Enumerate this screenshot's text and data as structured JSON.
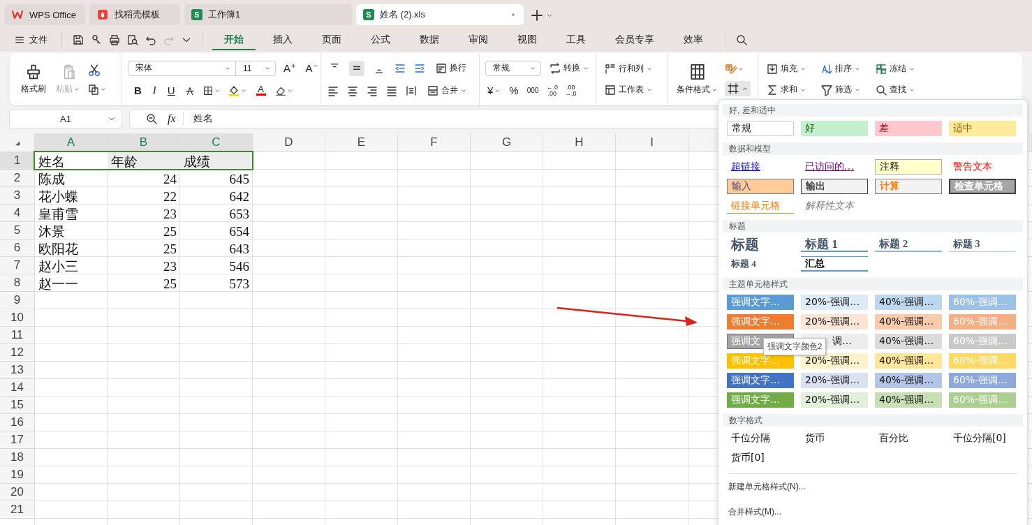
{
  "tabs": [
    {
      "label": "WPS Office",
      "kind": "wps",
      "selected": false
    },
    {
      "label": "找稻壳模板",
      "kind": "template",
      "selected": false
    },
    {
      "label": "工作簿1",
      "kind": "sheet",
      "badge": "S",
      "selected": false
    },
    {
      "label": "姓名 (2).xls",
      "kind": "sheet",
      "badge": "S",
      "selected": true
    }
  ],
  "menu": {
    "file": "文件",
    "tabs": [
      {
        "label": "开始",
        "selected": true
      },
      {
        "label": "插入",
        "selected": false
      },
      {
        "label": "页面",
        "selected": false
      },
      {
        "label": "公式",
        "selected": false
      },
      {
        "label": "数据",
        "selected": false
      },
      {
        "label": "审阅",
        "selected": false
      },
      {
        "label": "视图",
        "selected": false
      },
      {
        "label": "工具",
        "selected": false
      },
      {
        "label": "会员专享",
        "selected": false
      },
      {
        "label": "效率",
        "selected": false
      }
    ]
  },
  "ribbon": {
    "clipboard": {
      "format_painter": "格式刷",
      "paste": "粘贴",
      "paste_disabled": true
    },
    "font": {
      "name": "宋体",
      "size": "11",
      "grow": "A",
      "grow_mark": "+",
      "shrink": "A",
      "shrink_mark": "−",
      "bold": "B",
      "italic": "I",
      "underline": "U",
      "color_letter": "A"
    },
    "alignment": {
      "vertical": [
        {
          "selected": false
        },
        {
          "selected": true
        },
        {
          "selected": false
        }
      ],
      "wrap": "换行",
      "merge": "合并"
    },
    "number": {
      "format": "常规",
      "convert": "转换",
      "currency": "¥",
      "percent": "%",
      "thousands": "000",
      "inc_decimal": [
        "←.0",
        ".00"
      ],
      "dec_decimal": [
        ".00",
        "→.0"
      ]
    },
    "cells": {
      "rows_cols": "行和列",
      "worksheet": "工作表"
    },
    "styles": {
      "conditional": "条件格式",
      "cell_styles_expanded": true
    },
    "editing": [
      {
        "label": "填充",
        "kind": "fill"
      },
      {
        "label": "排序",
        "kind": "sort"
      },
      {
        "label": "冻结",
        "kind": "freeze"
      },
      {
        "label": "求和",
        "kind": "sum"
      },
      {
        "label": "筛选",
        "kind": "filter"
      },
      {
        "label": "查找",
        "kind": "find"
      }
    ]
  },
  "formula_bar": {
    "cell_ref": "A1",
    "fx": "fx",
    "value": "姓名"
  },
  "sheet": {
    "columns": [
      {
        "label": "A",
        "selected": true
      },
      {
        "label": "B",
        "selected": true
      },
      {
        "label": "C",
        "selected": true
      },
      {
        "label": "D",
        "selected": false
      },
      {
        "label": "E",
        "selected": false
      },
      {
        "label": "F",
        "selected": false
      },
      {
        "label": "G",
        "selected": false
      },
      {
        "label": "H",
        "selected": false
      },
      {
        "label": "I",
        "selected": false
      }
    ],
    "rows": [
      {
        "label": "1",
        "selected": true,
        "cells": [
          {
            "text": "姓名",
            "kind": "text"
          },
          {
            "text": "年龄",
            "kind": "text"
          },
          {
            "text": "成绩",
            "kind": "text"
          }
        ]
      },
      {
        "label": "2",
        "selected": false,
        "cells": [
          {
            "text": "陈成",
            "kind": "text"
          },
          {
            "text": "24",
            "kind": "number"
          },
          {
            "text": "645",
            "kind": "number"
          }
        ]
      },
      {
        "label": "3",
        "selected": false,
        "cells": [
          {
            "text": "花小蝶",
            "kind": "text"
          },
          {
            "text": "22",
            "kind": "number"
          },
          {
            "text": "642",
            "kind": "number"
          }
        ]
      },
      {
        "label": "4",
        "selected": false,
        "cells": [
          {
            "text": "皇甫雪",
            "kind": "text"
          },
          {
            "text": "23",
            "kind": "number"
          },
          {
            "text": "653",
            "kind": "number"
          }
        ]
      },
      {
        "label": "5",
        "selected": false,
        "cells": [
          {
            "text": "沐景",
            "kind": "text"
          },
          {
            "text": "25",
            "kind": "number"
          },
          {
            "text": "654",
            "kind": "number"
          }
        ]
      },
      {
        "label": "6",
        "selected": false,
        "cells": [
          {
            "text": "欧阳花",
            "kind": "text"
          },
          {
            "text": "25",
            "kind": "number"
          },
          {
            "text": "643",
            "kind": "number"
          }
        ]
      },
      {
        "label": "7",
        "selected": false,
        "cells": [
          {
            "text": "赵小三",
            "kind": "text"
          },
          {
            "text": "23",
            "kind": "number"
          },
          {
            "text": "546",
            "kind": "number"
          }
        ]
      },
      {
        "label": "8",
        "selected": false,
        "cells": [
          {
            "text": "赵一一",
            "kind": "text"
          },
          {
            "text": "25",
            "kind": "number"
          },
          {
            "text": "573",
            "kind": "number"
          }
        ]
      },
      {
        "label": "9",
        "selected": false
      },
      {
        "label": "10",
        "selected": false
      },
      {
        "label": "11",
        "selected": false
      },
      {
        "label": "12",
        "selected": false
      },
      {
        "label": "13",
        "selected": false
      },
      {
        "label": "14",
        "selected": false
      },
      {
        "label": "15",
        "selected": false
      },
      {
        "label": "16",
        "selected": false
      },
      {
        "label": "17",
        "selected": false
      },
      {
        "label": "18",
        "selected": false
      },
      {
        "label": "19",
        "selected": false
      },
      {
        "label": "20",
        "selected": false
      },
      {
        "label": "21",
        "selected": false
      }
    ]
  },
  "style_menu": {
    "sections": [
      {
        "title": "好, 差和适中",
        "items": [
          {
            "label": "常规",
            "kind": "normal"
          },
          {
            "label": "好",
            "kind": "good"
          },
          {
            "label": "差",
            "kind": "bad"
          },
          {
            "label": "适中",
            "kind": "neutral"
          }
        ]
      },
      {
        "title": "数据和模型",
        "items": [
          {
            "label": "超链接",
            "kind": "hyperlink"
          },
          {
            "label": "已访问的…",
            "kind": "visited"
          },
          {
            "label": "注释",
            "kind": "note"
          },
          {
            "label": "警告文本",
            "kind": "warning"
          },
          {
            "label": "输入",
            "kind": "input"
          },
          {
            "label": "输出",
            "kind": "output"
          },
          {
            "label": "计算",
            "kind": "calculation"
          },
          {
            "label": "检查单元格",
            "kind": "check"
          },
          {
            "label": "链接单元格",
            "kind": "linked"
          },
          {
            "label": "解释性文本",
            "kind": "explanatory"
          }
        ]
      },
      {
        "title": "标题",
        "items": [
          {
            "label": "标题",
            "kind": "title"
          },
          {
            "label": "标题 1",
            "kind": "heading1"
          },
          {
            "label": "标题 2",
            "kind": "heading2"
          },
          {
            "label": "标题 3",
            "kind": "heading3"
          },
          {
            "label": "标题 4",
            "kind": "heading4"
          },
          {
            "label": "汇总",
            "kind": "total"
          }
        ]
      },
      {
        "title": "主题单元格样式",
        "items": [
          {
            "label": "强调文字…",
            "kind": "accent",
            "color": "#5b9bd5",
            "hovered": false
          },
          {
            "label": "20%-强调…",
            "kind": "tint",
            "color": "#ddebf7",
            "hovered": false
          },
          {
            "label": "40%-强调…",
            "kind": "tint",
            "color": "#bdd7ee",
            "hovered": false
          },
          {
            "label": "60%-强调…",
            "kind": "accent",
            "color": "#9bc2e6",
            "hovered": false
          },
          {
            "label": "强调文字…",
            "kind": "accent",
            "color": "#ed7d31",
            "hovered": false
          },
          {
            "label": "20%-强调…",
            "kind": "tint",
            "color": "#fce4d6",
            "hovered": false
          },
          {
            "label": "40%-强调…",
            "kind": "tint",
            "color": "#f8cbad",
            "hovered": false
          },
          {
            "label": "60%-强调…",
            "kind": "accent",
            "color": "#f4b084",
            "hovered": false
          },
          {
            "label": "强调文",
            "kind": "accent",
            "color": "#a5a5a5",
            "hovered": true
          },
          {
            "label": "调…",
            "kind": "tint",
            "color": "#ededed",
            "hovered": false
          },
          {
            "label": "40%-强调…",
            "kind": "tint",
            "color": "#dbdbdb",
            "hovered": false
          },
          {
            "label": "60%-强调…",
            "kind": "accent",
            "color": "#c9c9c9",
            "hovered": false
          },
          {
            "label": "强调文字…",
            "kind": "accent",
            "color": "#ffc000",
            "hovered": false
          },
          {
            "label": "20%-强调…",
            "kind": "tint",
            "color": "#fff2cc",
            "hovered": false
          },
          {
            "label": "40%-强调…",
            "kind": "tint",
            "color": "#ffe699",
            "hovered": false
          },
          {
            "label": "60%-强调…",
            "kind": "accent",
            "color": "#ffd966",
            "hovered": false
          },
          {
            "label": "强调文字…",
            "kind": "accent",
            "color": "#4472c4",
            "hovered": false
          },
          {
            "label": "20%-强调…",
            "kind": "tint",
            "color": "#d9e1f2",
            "hovered": false
          },
          {
            "label": "40%-强调…",
            "kind": "tint",
            "color": "#b4c6e7",
            "hovered": false
          },
          {
            "label": "60%-强调…",
            "kind": "accent",
            "color": "#8ea9db",
            "hovered": false
          },
          {
            "label": "强调文字…",
            "kind": "accent",
            "color": "#70ad47",
            "hovered": false
          },
          {
            "label": "20%-强调…",
            "kind": "tint",
            "color": "#e2efda",
            "hovered": false
          },
          {
            "label": "40%-强调…",
            "kind": "tint",
            "color": "#c6e0b4",
            "hovered": false
          },
          {
            "label": "60%-强调…",
            "kind": "accent",
            "color": "#a9d08e",
            "hovered": false
          }
        ]
      },
      {
        "title": "数字格式",
        "items": [
          {
            "label": "千位分隔",
            "kind": "plain"
          },
          {
            "label": "货币",
            "kind": "plain"
          },
          {
            "label": "百分比",
            "kind": "plain"
          },
          {
            "label": "千位分隔[0]",
            "kind": "plain"
          },
          {
            "label": "货币[0]",
            "kind": "plain"
          }
        ]
      }
    ],
    "actions": [
      "新建单元格样式(N)...",
      "合并样式(M)..."
    ],
    "tooltip": "强调文字颜色2"
  }
}
